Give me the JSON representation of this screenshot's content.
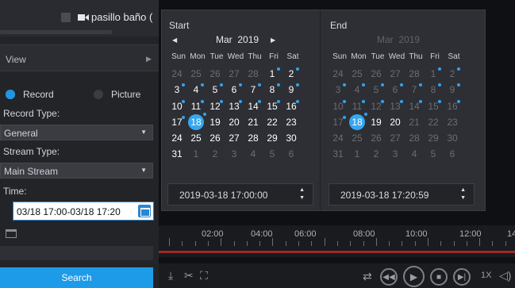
{
  "camera": {
    "label": "pasillo baño (",
    "checked": false,
    "icon": "video-camera-icon"
  },
  "view": {
    "label": "View",
    "arrow_icon": "chevron-right-icon"
  },
  "mode": {
    "options": [
      "Record",
      "Picture"
    ],
    "selected": "Record"
  },
  "record_type": {
    "label": "Record Type:",
    "value": "General"
  },
  "stream_type": {
    "label": "Stream Type:",
    "value": "Main Stream"
  },
  "time": {
    "label": "Time:",
    "value": "03/18 17:00-03/18 17:20",
    "icon": "calendar-icon"
  },
  "search": {
    "label": "Search"
  },
  "calendar": {
    "weekdays": [
      "Sun",
      "Mon",
      "Tue",
      "Wed",
      "Thu",
      "Fri",
      "Sat"
    ],
    "start": {
      "title": "Start",
      "month": "Mar",
      "year": "2019",
      "time": "2019-03-18 17:00:00",
      "selected_day": 18,
      "days_with_records": [
        1,
        2,
        3,
        4,
        5,
        6,
        7,
        8,
        9,
        10,
        11,
        12,
        13,
        14,
        15,
        16,
        17,
        18
      ]
    },
    "end": {
      "title": "End",
      "month": "Mar",
      "year": "2019",
      "time": "2019-03-18 17:20:59",
      "selected_day": 18,
      "days_with_records": [
        1,
        2,
        3,
        4,
        5,
        6,
        7,
        8,
        9,
        10,
        11,
        12,
        13,
        14,
        15,
        16,
        17,
        18
      ]
    },
    "weeks": [
      [
        "24",
        "25",
        "26",
        "27",
        "28",
        "1",
        "2"
      ],
      [
        "3",
        "4",
        "5",
        "6",
        "7",
        "8",
        "9"
      ],
      [
        "10",
        "11",
        "12",
        "13",
        "14",
        "15",
        "16"
      ],
      [
        "17",
        "18",
        "19",
        "20",
        "21",
        "22",
        "23"
      ],
      [
        "24",
        "25",
        "26",
        "27",
        "28",
        "29",
        "30"
      ],
      [
        "31",
        "1",
        "2",
        "3",
        "4",
        "5",
        "6"
      ]
    ]
  },
  "timeline": {
    "labels": [
      "02:00",
      "04:00",
      "06:00",
      "08:00",
      "10:00",
      "12:00",
      "14"
    ]
  },
  "playback": {
    "speed": "1X"
  },
  "colors": {
    "accent": "#1e9be8",
    "record_dot": "#2ea3ef",
    "timeline_record": "#9c2a2a"
  }
}
